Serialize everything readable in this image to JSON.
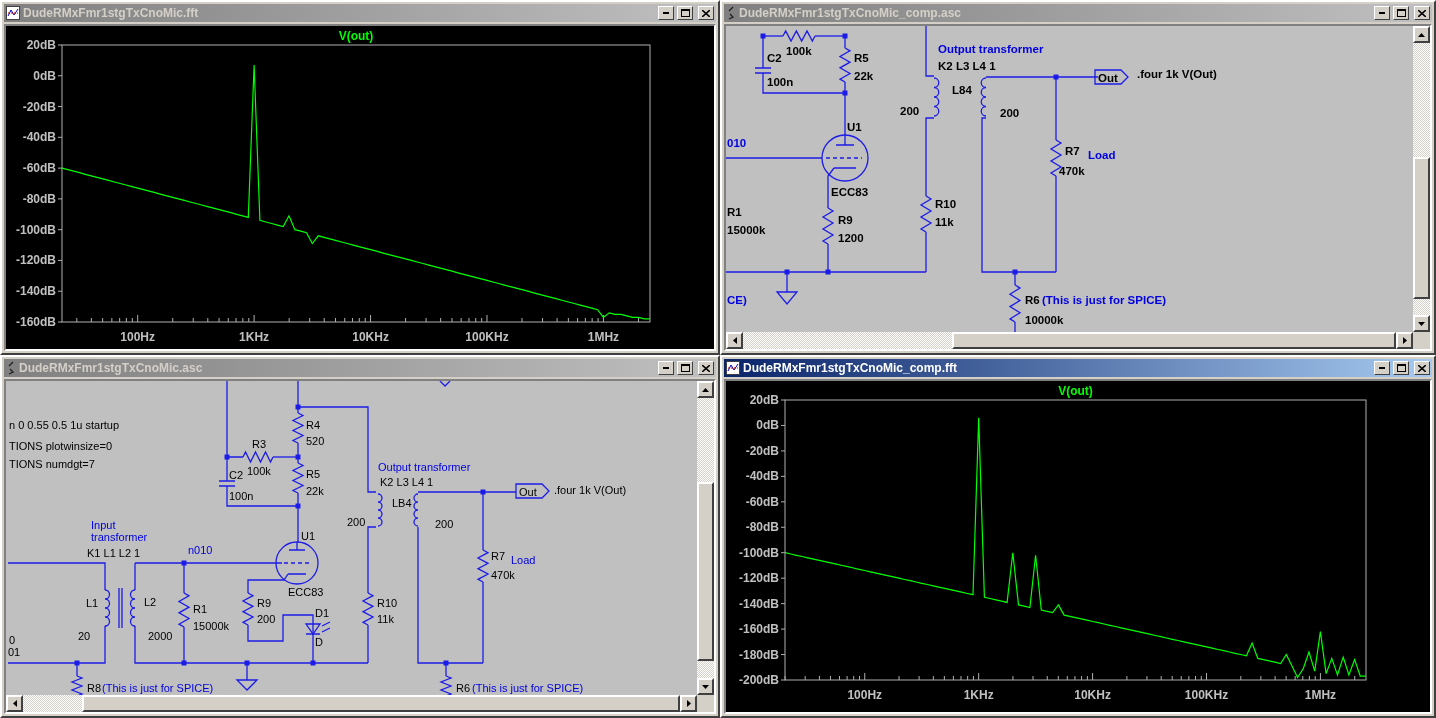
{
  "windows": [
    {
      "kind": "plot",
      "title": "DudeRMxFmr1stgTxCnoMic.fft",
      "active": false,
      "chart_data": {
        "type": "line",
        "ylim": [
          -160,
          20
        ],
        "yticks": [
          {
            "value": 20,
            "label": "20dB"
          },
          {
            "value": 0,
            "label": "0dB"
          },
          {
            "value": -20,
            "label": "-20dB"
          },
          {
            "value": -40,
            "label": "-40dB"
          },
          {
            "value": -60,
            "label": "-60dB"
          },
          {
            "value": -80,
            "label": "-80dB"
          },
          {
            "value": -100,
            "label": "-100dB"
          },
          {
            "value": -120,
            "label": "-120dB"
          },
          {
            "value": -140,
            "label": "-140dB"
          },
          {
            "value": -160,
            "label": "-160dB"
          }
        ],
        "categories": [
          null,
          null,
          null,
          null,
          null,
          null,
          null,
          null,
          null,
          null,
          null,
          null,
          null,
          "100Hz",
          null,
          null,
          null,
          null,
          null,
          null,
          null,
          null,
          null,
          null,
          null,
          null,
          null,
          null,
          null,
          null,
          null,
          null,
          null,
          "1KHz",
          null,
          null,
          null,
          null,
          null,
          null,
          null,
          null,
          null,
          null,
          null,
          null,
          null,
          null,
          null,
          null,
          null,
          null,
          null,
          "10KHz",
          null,
          null,
          null,
          null,
          null,
          null,
          null,
          null,
          null,
          null,
          null,
          null,
          null,
          null,
          null,
          null,
          null,
          null,
          null,
          "100KHz",
          null,
          null,
          null,
          null,
          null,
          null,
          null,
          null,
          null,
          null,
          null,
          null,
          null,
          null,
          null,
          null,
          null,
          null,
          null,
          "1MHz",
          null,
          null,
          null,
          null,
          null,
          null,
          null,
          null
        ],
        "series": [
          {
            "name": "V(out)",
            "color": "#00ff00",
            "values": [
              -60,
              -61,
              -62,
              -63,
              -64,
              -65,
              -66,
              -67,
              -68,
              -69,
              -70,
              -71,
              -72,
              -73,
              -74,
              -75,
              -76,
              -77,
              -78,
              -79,
              -80,
              -81,
              -82,
              -83,
              -84,
              -85,
              -86,
              -87,
              -88,
              -89,
              -90,
              -91,
              -92,
              7,
              -94,
              -95,
              -96,
              -97,
              -98,
              -91,
              -100,
              -101,
              -102,
              -109,
              -104,
              -105,
              -106,
              -107,
              -108,
              -109,
              -110,
              -111,
              -112,
              -113,
              -114,
              -115,
              -116,
              -117,
              -118,
              -119,
              -120,
              -121,
              -122,
              -123,
              -124,
              -125,
              -126,
              -127,
              -128,
              -129,
              -130,
              -131,
              -132,
              -133,
              -134,
              -135,
              -136,
              -137,
              -138,
              -139,
              -140,
              -141,
              -142,
              -143,
              -144,
              -145,
              -146,
              -147,
              -148,
              -149,
              -150,
              -151,
              -152,
              -157,
              -154,
              -155,
              -155,
              -156,
              -157,
              -157,
              -158,
              -158
            ]
          }
        ]
      }
    },
    {
      "kind": "schematic",
      "title": "DudeRMxFmr1stgTxCnoMic_comp.asc",
      "active": false,
      "labels": [
        {
          "text": "100k",
          "kind": "part"
        },
        {
          "text": "C2",
          "kind": "part"
        },
        {
          "text": "R5",
          "kind": "part"
        },
        {
          "text": "100n",
          "kind": "part"
        },
        {
          "text": "22k",
          "kind": "part"
        },
        {
          "text": "Output transformer",
          "kind": "net"
        },
        {
          "text": "K2 L3 L4 1",
          "kind": "part"
        },
        {
          "text": "Out",
          "kind": "port"
        },
        {
          "text": ".four 1k V(Out)",
          "kind": "part"
        },
        {
          "text": "L84",
          "kind": "part"
        },
        {
          "text": "200",
          "kind": "part"
        },
        {
          "text": "200",
          "kind": "part"
        },
        {
          "text": "U1",
          "kind": "part"
        },
        {
          "text": "010",
          "kind": "net"
        },
        {
          "text": "R7",
          "kind": "part"
        },
        {
          "text": "Load",
          "kind": "net"
        },
        {
          "text": "470k",
          "kind": "part"
        },
        {
          "text": "ECC83",
          "kind": "part"
        },
        {
          "text": "R1",
          "kind": "part"
        },
        {
          "text": "R10",
          "kind": "part"
        },
        {
          "text": "15000k",
          "kind": "part"
        },
        {
          "text": "R9",
          "kind": "part"
        },
        {
          "text": "11k",
          "kind": "part"
        },
        {
          "text": "1200",
          "kind": "part"
        },
        {
          "text": "CE)",
          "kind": "net"
        },
        {
          "text": "R6",
          "kind": "part"
        },
        {
          "text": "(This is just for SPICE)",
          "kind": "net"
        },
        {
          "text": "10000k",
          "kind": "part"
        }
      ]
    },
    {
      "kind": "schematic",
      "title": "DudeRMxFmr1stgTxCnoMic.asc",
      "active": false,
      "labels": [
        {
          "text": "n 0 0.55 0.5 1u startup",
          "kind": "part"
        },
        {
          "text": "R4",
          "kind": "part"
        },
        {
          "text": "TIONS plotwinsize=0",
          "kind": "part"
        },
        {
          "text": "R3",
          "kind": "part"
        },
        {
          "text": "520",
          "kind": "part"
        },
        {
          "text": "TIONS numdgt=7",
          "kind": "part"
        },
        {
          "text": "C2",
          "kind": "part"
        },
        {
          "text": "100k",
          "kind": "part"
        },
        {
          "text": "R5",
          "kind": "part"
        },
        {
          "text": "Output transformer",
          "kind": "net"
        },
        {
          "text": "100n",
          "kind": "part"
        },
        {
          "text": "22k",
          "kind": "part"
        },
        {
          "text": "K2 L3 L4 1",
          "kind": "part"
        },
        {
          "text": "Out",
          "kind": "port"
        },
        {
          "text": ".four 1k V(Out)",
          "kind": "part"
        },
        {
          "text": "LB4",
          "kind": "part"
        },
        {
          "text": "Input",
          "kind": "net"
        },
        {
          "text": "200",
          "kind": "part"
        },
        {
          "text": "200",
          "kind": "part"
        },
        {
          "text": "transformer",
          "kind": "net"
        },
        {
          "text": "U1",
          "kind": "part"
        },
        {
          "text": "K1 L1 L2 1",
          "kind": "part"
        },
        {
          "text": "n010",
          "kind": "net"
        },
        {
          "text": "R7",
          "kind": "part"
        },
        {
          "text": "Load",
          "kind": "net"
        },
        {
          "text": "470k",
          "kind": "part"
        },
        {
          "text": "ECC83",
          "kind": "part"
        },
        {
          "text": "L1",
          "kind": "part"
        },
        {
          "text": "L2",
          "kind": "part"
        },
        {
          "text": "R1",
          "kind": "part"
        },
        {
          "text": "R9",
          "kind": "part"
        },
        {
          "text": "D1",
          "kind": "part"
        },
        {
          "text": "R10",
          "kind": "part"
        },
        {
          "text": "15000k",
          "kind": "part"
        },
        {
          "text": "200",
          "kind": "part"
        },
        {
          "text": "11k",
          "kind": "part"
        },
        {
          "text": "20",
          "kind": "part"
        },
        {
          "text": "2000",
          "kind": "part"
        },
        {
          "text": "0",
          "kind": "part"
        },
        {
          "text": "D",
          "kind": "part"
        },
        {
          "text": "01",
          "kind": "part"
        },
        {
          "text": "R8",
          "kind": "part"
        },
        {
          "text": "(This is just for SPICE)",
          "kind": "net"
        },
        {
          "text": "R6",
          "kind": "part"
        },
        {
          "text": "(This is just for SPICE)",
          "kind": "net"
        }
      ]
    },
    {
      "kind": "plot",
      "title": "DudeRMxFmr1stgTxCnoMic_comp.fft",
      "active": true,
      "chart_data": {
        "type": "line",
        "ylim": [
          -200,
          20
        ],
        "yticks": [
          {
            "value": 20,
            "label": "20dB"
          },
          {
            "value": 0,
            "label": "0dB"
          },
          {
            "value": -20,
            "label": "-20dB"
          },
          {
            "value": -40,
            "label": "-40dB"
          },
          {
            "value": -60,
            "label": "-60dB"
          },
          {
            "value": -80,
            "label": "-80dB"
          },
          {
            "value": -100,
            "label": "-100dB"
          },
          {
            "value": -120,
            "label": "-120dB"
          },
          {
            "value": -140,
            "label": "-140dB"
          },
          {
            "value": -160,
            "label": "-160dB"
          },
          {
            "value": -180,
            "label": "-180dB"
          },
          {
            "value": -200,
            "label": "-200dB"
          }
        ],
        "categories": [
          null,
          null,
          null,
          null,
          null,
          null,
          null,
          null,
          null,
          null,
          null,
          null,
          null,
          null,
          "100Hz",
          null,
          null,
          null,
          null,
          null,
          null,
          null,
          null,
          null,
          null,
          null,
          null,
          null,
          null,
          null,
          null,
          null,
          null,
          null,
          "1KHz",
          null,
          null,
          null,
          null,
          null,
          null,
          null,
          null,
          null,
          null,
          null,
          null,
          null,
          null,
          null,
          null,
          null,
          null,
          null,
          "10KHz",
          null,
          null,
          null,
          null,
          null,
          null,
          null,
          null,
          null,
          null,
          null,
          null,
          null,
          null,
          null,
          null,
          null,
          null,
          null,
          "100KHz",
          null,
          null,
          null,
          null,
          null,
          null,
          null,
          null,
          null,
          null,
          null,
          null,
          null,
          null,
          null,
          null,
          null,
          null,
          null,
          "1MHz",
          null,
          null,
          null,
          null,
          null,
          null,
          null,
          null
        ],
        "series": [
          {
            "name": "V(out)",
            "color": "#00ff00",
            "values": [
              -100,
              -101,
              -102,
              -103,
              -104,
              -105,
              -106,
              -107,
              -108,
              -109,
              -110,
              -111,
              -112,
              -113,
              -114,
              -115,
              -116,
              -117,
              -118,
              -119,
              -120,
              -121,
              -122,
              -123,
              -124,
              -125,
              -126,
              -127,
              -128,
              -129,
              -130,
              -131,
              -132,
              -133,
              6,
              -135,
              -136,
              -137,
              -138,
              -139,
              -100,
              -141,
              -142,
              -143,
              -102,
              -145,
              -146,
              -147,
              -141,
              -149,
              -150,
              -151,
              -152,
              -153,
              -154,
              -155,
              -156,
              -157,
              -158,
              -159,
              -160,
              -161,
              -162,
              -163,
              -164,
              -165,
              -166,
              -167,
              -168,
              -169,
              -170,
              -171,
              -172,
              -173,
              -174,
              -175,
              -176,
              -177,
              -178,
              -179,
              -180,
              -181,
              -171,
              -183,
              -184,
              -185,
              -186,
              -187,
              -180,
              -189,
              -198,
              -191,
              -178,
              -193,
              -162,
              -195,
              -183,
              -196,
              -182,
              -196,
              -184,
              -197,
              -197
            ]
          }
        ]
      }
    }
  ]
}
